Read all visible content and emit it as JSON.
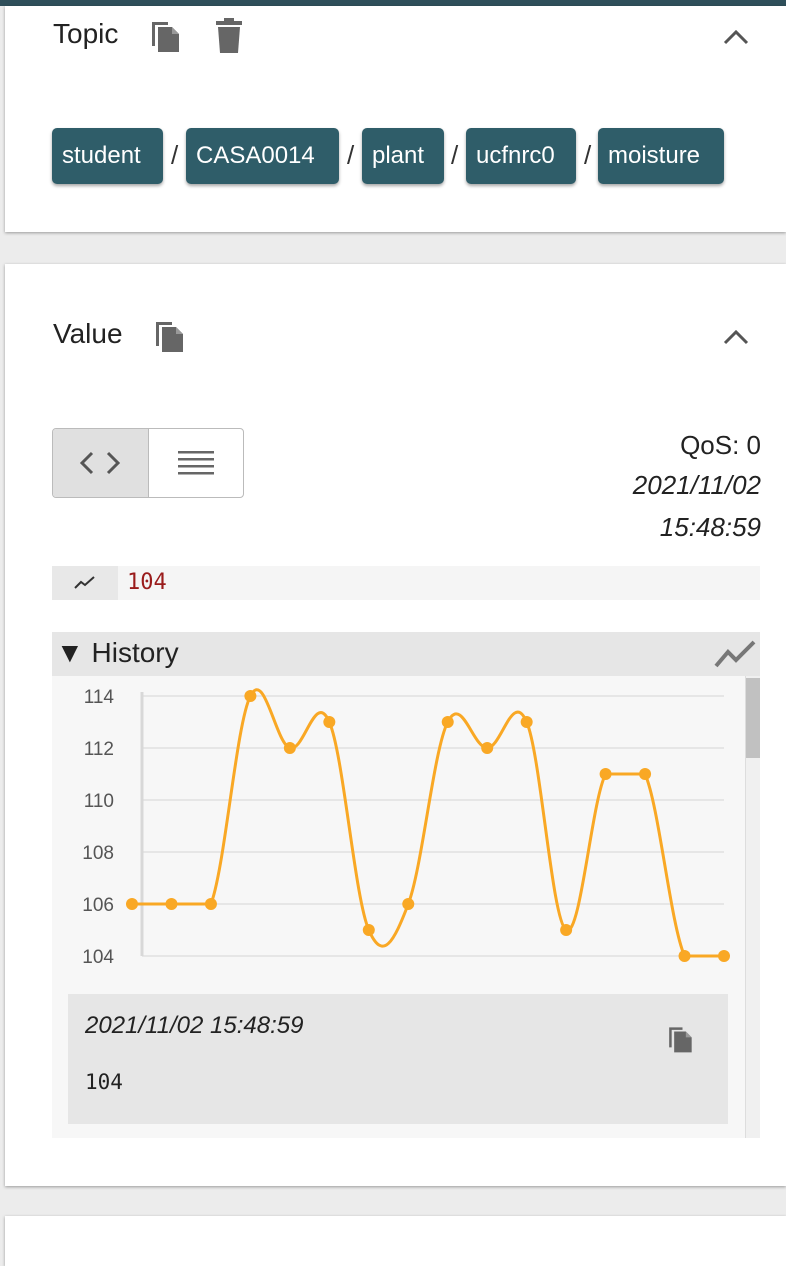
{
  "topic": {
    "title": "Topic",
    "segments": [
      "student",
      "CASA0014",
      "plant",
      "ucfnrc0",
      "moisture"
    ],
    "separator": "/",
    "icons": [
      "copy-icon",
      "delete-icon",
      "chevron-up-icon"
    ]
  },
  "value": {
    "title": "Value",
    "qos": "QoS: 0",
    "date": "2021/11/02",
    "time": "15:48:59",
    "current_value": "104",
    "icons": [
      "copy-icon",
      "chevron-up-icon",
      "code-view-icon",
      "raw-text-view-icon",
      "trend-icon"
    ]
  },
  "history": {
    "label": "History",
    "toggle_glyph": "▼",
    "selected_timestamp": "2021/11/02 15:48:59",
    "selected_value": "104",
    "chart_icon": "line-chart-icon"
  },
  "chart_data": {
    "type": "line",
    "x": [
      1,
      2,
      3,
      4,
      5,
      6,
      7,
      8,
      9,
      10,
      11,
      12,
      13,
      14,
      15,
      16
    ],
    "values": [
      106,
      106,
      106,
      114,
      112,
      113,
      105,
      106,
      113,
      112,
      113,
      105,
      111,
      111,
      104,
      104
    ],
    "yticks": [
      114,
      112,
      110,
      108,
      106,
      104
    ],
    "ylim": [
      104,
      114
    ],
    "grid": true,
    "color": "#f9a825"
  },
  "colors": {
    "chip": "#2f5d69",
    "topbar": "#2f4f5a",
    "value_text": "#9a1c1c",
    "line": "#f9a825"
  }
}
